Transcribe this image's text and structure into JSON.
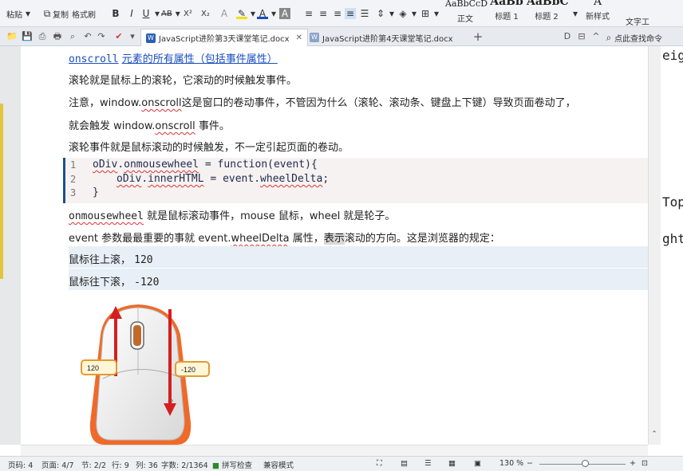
{
  "ribbon": {
    "paste": "粘贴",
    "copy": "复制",
    "format_painter": "格式刷",
    "bold": "B",
    "italic": "I",
    "underline": "U",
    "strike_label": "AB",
    "superscript": "X²",
    "subscript": "X₂",
    "styles": [
      {
        "preview": "AaBbCcD",
        "label": "正文"
      },
      {
        "preview": "AaBb",
        "label": "标题 1"
      },
      {
        "preview": "AaBbC",
        "label": "标题 2"
      }
    ],
    "new_style": "新样式",
    "text_tool": "文字工"
  },
  "tabs": [
    {
      "label": "JavaScript进阶第3天课堂笔记.docx",
      "active": true
    },
    {
      "label": "JavaScript进阶第4天课堂笔记.docx",
      "active": false
    }
  ],
  "search": {
    "label": "点此查找命令"
  },
  "document": {
    "heading_code": "onscroll",
    "heading_text": "元素的所有属性（包括事件属性）",
    "p1": "滚轮就是鼠标上的滚轮，它滚动的时候触发事件。",
    "p2_a": "注意，window.",
    "p2_b": "onscroll",
    "p2_c": "这是窗口的卷动事件，不管因为什么（滚轮、滚动条、键盘上下键）导致页面卷动了，",
    "p3_a": "就会触发",
    "p3_b": "window.",
    "p3_c": "onscroll",
    "p3_d": "事件。",
    "p4": "滚轮事件就是鼠标滚动的时候触发，不一定引起页面的卷动。",
    "code": [
      {
        "num": "1",
        "a": "oDiv",
        "b": ".",
        "c": "onmousewheel",
        "d": " = function(event){"
      },
      {
        "num": "2",
        "a": "oDiv",
        "b": ".",
        "c": "innerHTML",
        "d": " = event.",
        "e": "wheelDelta",
        "f": ";"
      },
      {
        "num": "3",
        "a": "}"
      }
    ],
    "p5_a": "onmousewheel",
    "p5_b": "就是鼠标滚动事件，mouse 鼠标，wheel 就是轮子。",
    "p6_a": "event 参数最最重要的事就",
    "p6_b": "event.",
    "p6_c": "wheelDelta",
    "p6_d": "属性，",
    "p6_e": "表示",
    "p6_f": "滚动的方向。这是浏览器的规定：",
    "row1_label": "鼠标往上滚，",
    "row1_value": "120",
    "row2_label": "鼠标往下滚，",
    "row2_value": "-120",
    "mouse_up_label": "120",
    "mouse_down_label": "-120"
  },
  "right_panel": [
    "eig",
    "Top",
    "ght"
  ],
  "status": {
    "page": "页码: 4",
    "pages": "页面: 4/7",
    "section": "节: 2/2",
    "row": "行: 9",
    "col": "列: 36",
    "words": "字数: 2/1364",
    "spell": "拼写检查",
    "compat": "兼容模式",
    "zoom": "130 %"
  },
  "colors": {
    "accent_blue": "#1d4f8c",
    "link_blue": "#1a4ec1",
    "arrow_red": "#d41f1f",
    "mouse_orange": "#ef6a2a"
  }
}
